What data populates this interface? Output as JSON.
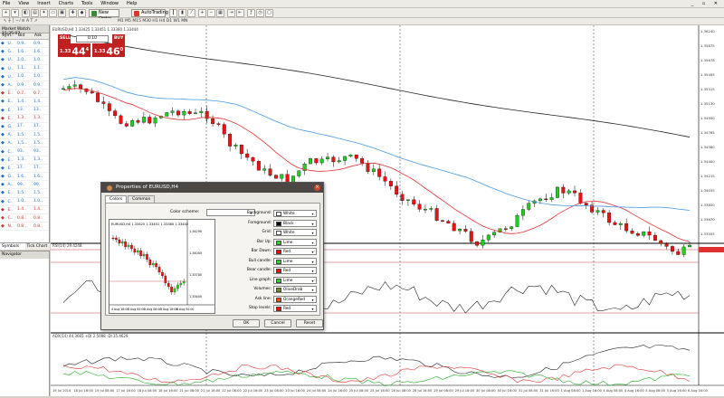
{
  "menu": [
    "File",
    "View",
    "Insert",
    "Charts",
    "Tools",
    "Window",
    "Help"
  ],
  "toolbar": {
    "new_order": "New Order",
    "autotrading": "AutoTrading",
    "timeframes": "M1  M5  M15  M30  H1  H4  D1  W1  MN"
  },
  "market_watch": {
    "header": "Market Watch: 15:35:07",
    "columns": [
      "Sym..",
      "Bid",
      "Ask"
    ],
    "rows": [
      {
        "sym": "U..",
        "bid": "0.9..",
        "ask": "0.9..",
        "dir": "up"
      },
      {
        "sym": "G..",
        "bid": "1.6..",
        "ask": "1.6..",
        "dir": "up"
      },
      {
        "sym": "U..",
        "bid": "1.0..",
        "ask": "1.0..",
        "dir": "up"
      },
      {
        "sym": "U..",
        "bid": "1.1..",
        "ask": "1.1..",
        "dir": "up"
      },
      {
        "sym": "U..",
        "bid": "1.0..",
        "ask": "1.0..",
        "dir": "up"
      },
      {
        "sym": "A..",
        "bid": "0.9..",
        "ask": "0.9..",
        "dir": "up"
      },
      {
        "sym": "E..",
        "bid": "0.7..",
        "ask": "0.7..",
        "dir": "down"
      },
      {
        "sym": "E..",
        "bid": "1.4..",
        "ask": "1.4..",
        "dir": "up"
      },
      {
        "sym": "E..",
        "bid": "13..",
        "ask": "13..",
        "dir": "up"
      },
      {
        "sym": "E..",
        "bid": "1.3..",
        "ask": "1.3..",
        "dir": "down"
      },
      {
        "sym": "G..",
        "bid": "17..",
        "ask": "17..",
        "dir": "up"
      },
      {
        "sym": "A..",
        "bid": "1.5..",
        "ask": "1.5..",
        "dir": "up"
      },
      {
        "sym": "A..",
        "bid": "1.5..",
        "ask": "1.5..",
        "dir": "up"
      },
      {
        "sym": "C..",
        "bid": "93..",
        "ask": "93..",
        "dir": "up"
      },
      {
        "sym": "E..",
        "bid": "1.3..",
        "ask": "1.3..",
        "dir": "up"
      },
      {
        "sym": "E..",
        "bid": "17..",
        "ask": "17..",
        "dir": "up"
      },
      {
        "sym": "G..",
        "bid": "1.6..",
        "ask": "1.6..",
        "dir": "up"
      },
      {
        "sym": "A..",
        "bid": "99..",
        "ask": "99..",
        "dir": "up"
      },
      {
        "sym": "E..",
        "bid": "1.5..",
        "ask": "1.5..",
        "dir": "up"
      },
      {
        "sym": "C..",
        "bid": "1.0..",
        "ask": "1.0..",
        "dir": "up"
      },
      {
        "sym": "E..",
        "bid": "1.4..",
        "ask": "1.4..",
        "dir": "down"
      },
      {
        "sym": "C..",
        "bid": "0.8..",
        "ask": "0.8..",
        "dir": "down"
      },
      {
        "sym": "N..",
        "bid": "0.8..",
        "ask": "0.8..",
        "dir": "down"
      }
    ],
    "tabs": [
      "Symbols",
      "Tick Chart"
    ]
  },
  "navigator": {
    "title": "Navigator"
  },
  "chart": {
    "symbol_line": "EURUSD,H4  1.33425 1.33451 1.33380 1.33444",
    "one_click": {
      "sell": "SELL",
      "buy": "BUY",
      "lot": "0.10",
      "sell_price_small": "1.33",
      "sell_price_big": "44",
      "sell_sup": "4",
      "buy_price_small": "1.33",
      "buy_price_big": "46",
      "buy_sup": "0"
    },
    "rsi_label": "RSI(14) 29.4248",
    "adx_label": "ADX(14) 44.3665  +DI 2.5098  -DI 35.4629",
    "price_labels": [
      "1.36240",
      "1.35875",
      "1.35678",
      "1.35495",
      "1.35315",
      "1.35130",
      "1.34950",
      "1.34765",
      "1.34580",
      "1.34400",
      "1.34215",
      "1.34035",
      "1.33850",
      "1.33670",
      "1.33555"
    ],
    "time_labels": [
      "19 Jul 2014",
      "18 Jul 16:00",
      "19 Jul 08:00",
      "17 Jul 16:00",
      "18 Jul 08:00",
      "18 Jul 16:00",
      "21 Jul 08:00",
      "21 Jul 16:00",
      "22 Jul 08:00",
      "22 Jul 16:00",
      "23 Jul 08:00",
      "23 Jul 16:00",
      "24 Jul 08:00",
      "24 Jul 16:00",
      "25 Jul 08:00",
      "25 Jul 16:00",
      "28 Jul 08:00",
      "28 Jul 16:00",
      "29 Jul 08:00",
      "29 Jul 16:00",
      "30 Jul 08:00",
      "30 Jul 16:00",
      "31 Jul 08:00",
      "31 Jul 16:00",
      "1 Aug 08:00",
      "1 Aug 16:00",
      "4 Aug 08:00",
      "4 Aug 16:00",
      "5 Aug 08:00",
      "5 Aug 16:00",
      "6 Aug 04:00"
    ]
  },
  "dialog": {
    "title": "Properties of EURUSD,H4",
    "tabs": [
      "Colors",
      "Common"
    ],
    "color_scheme_label": "Color scheme:",
    "preview_header": "EURUSD,H4  1.33425 1.33451 1.33380 1.33442",
    "preview_prices": [
      "1.34290",
      "1.34000",
      "1.33700",
      "1.33400"
    ],
    "preview_times": [
      "4 Aug 16:00",
      "5 Aug 00:00",
      "5 Aug 08:00",
      "5 Aug 16:00",
      "6 Aug 00:00"
    ],
    "properties": [
      {
        "label": "Background:",
        "value": "White",
        "color": "#ffffff"
      },
      {
        "label": "Foreground:",
        "value": "Black",
        "color": "#000000"
      },
      {
        "label": "Grid:",
        "value": "White",
        "color": "#ffffff"
      },
      {
        "label": "Bar Up:",
        "value": "Lime",
        "color": "#32cd32"
      },
      {
        "label": "Bar Down:",
        "value": "Red",
        "color": "#ff0000"
      },
      {
        "label": "Bull candle:",
        "value": "Lime",
        "color": "#32cd32"
      },
      {
        "label": "Bear candle:",
        "value": "Red",
        "color": "#ff0000"
      },
      {
        "label": "Line graph:",
        "value": "Lime",
        "color": "#32cd32"
      },
      {
        "label": "Volumes:",
        "value": "OliveDrab",
        "color": "#6b8e23"
      },
      {
        "label": "Ask line:",
        "value": "OrangeRed",
        "color": "#ff4500"
      },
      {
        "label": "Stop levels:",
        "value": "Red",
        "color": "#ff0000"
      }
    ],
    "ok": "OK",
    "cancel": "Cancel",
    "reset": "Reset"
  }
}
